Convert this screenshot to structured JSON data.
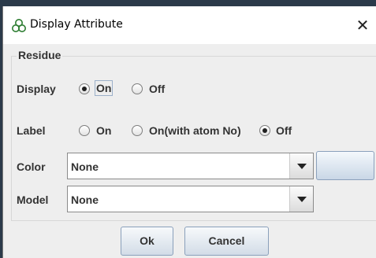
{
  "window": {
    "title": "Display Attribute",
    "close_glyph": "✕",
    "icon": "molecule-icon"
  },
  "residue": {
    "group_title": "Residue",
    "display": {
      "label": "Display",
      "options": [
        "On",
        "Off"
      ],
      "selected": "On"
    },
    "label_row": {
      "label": "Label",
      "options": [
        "On",
        "On(with atom No)",
        "Off"
      ],
      "selected": "Off"
    },
    "color": {
      "label": "Color",
      "value": "None"
    },
    "model": {
      "label": "Model",
      "value": "None"
    }
  },
  "buttons": {
    "ok": "Ok",
    "cancel": "Cancel"
  }
}
